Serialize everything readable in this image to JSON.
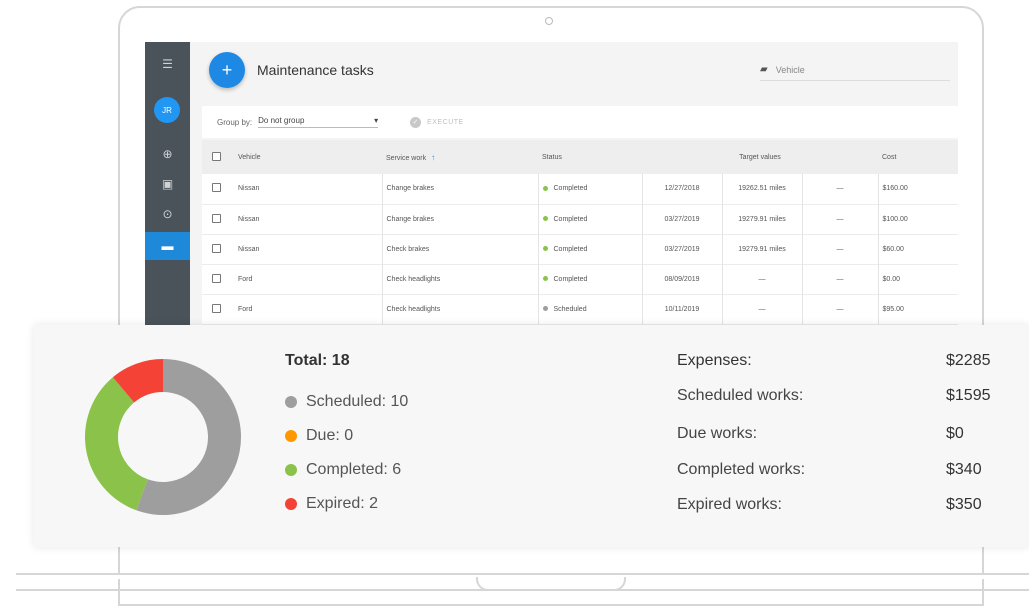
{
  "app": {
    "title": "Maintenance tasks",
    "fab_label": "+",
    "vehicle_filter_placeholder": "Vehicle",
    "avatar_initials": "JR"
  },
  "toolbar": {
    "group_by_label": "Group by:",
    "group_by_value": "Do not group",
    "execute_label": "EXECUTE"
  },
  "table": {
    "headers": [
      "Vehicle",
      "Service work",
      "Status",
      "Target values",
      "Cost"
    ],
    "rows": [
      {
        "vehicle": "Nissan",
        "service": "Change brakes",
        "status": "Completed",
        "date": "12/27/2018",
        "miles": "19262.51 miles",
        "other": "—",
        "cost": "$160.00"
      },
      {
        "vehicle": "Nissan",
        "service": "Change brakes",
        "status": "Completed",
        "date": "03/27/2019",
        "miles": "19279.91 miles",
        "other": "—",
        "cost": "$100.00"
      },
      {
        "vehicle": "Nissan",
        "service": "Check brakes",
        "status": "Completed",
        "date": "03/27/2019",
        "miles": "19279.91 miles",
        "other": "—",
        "cost": "$60.00"
      },
      {
        "vehicle": "Ford",
        "service": "Check headlights",
        "status": "Completed",
        "date": "08/09/2019",
        "miles": "—",
        "other": "—",
        "cost": "$0.00"
      },
      {
        "vehicle": "Ford",
        "service": "Check headlights",
        "status": "Scheduled",
        "date": "10/11/2019",
        "miles": "—",
        "other": "—",
        "cost": "$95.00"
      }
    ]
  },
  "summary": {
    "total": "Total: 18",
    "legend": [
      {
        "label": "Scheduled: 10",
        "color": "#9e9e9e"
      },
      {
        "label": "Due: 0",
        "color": "#ff9800"
      },
      {
        "label": "Completed: 6",
        "color": "#8bc34a"
      },
      {
        "label": "Expired: 2",
        "color": "#f44336"
      }
    ],
    "expenses": [
      {
        "label": "Expenses:",
        "value": "$2285"
      },
      {
        "label": "Scheduled works:",
        "value": "$1595"
      },
      {
        "label": "Due works:",
        "value": "$0"
      },
      {
        "label": "Completed works:",
        "value": "$340"
      },
      {
        "label": "Expired works:",
        "value": "$350"
      }
    ],
    "donut": {
      "scheduled": 10,
      "due": 0,
      "completed": 6,
      "expired": 2
    }
  },
  "colors": {
    "accent": "#1e88e5",
    "sidebar": "#4a525a",
    "completed": "#8bc34a",
    "scheduled": "#9e9e9e",
    "expired": "#f44336",
    "due": "#ff9800"
  },
  "icons": {
    "sidebar": [
      "menu-icon",
      "globe-icon",
      "chart-icon",
      "location-icon",
      "car-icon"
    ],
    "vehicle_filter": "car-icon",
    "execute": "check-circle-icon"
  }
}
